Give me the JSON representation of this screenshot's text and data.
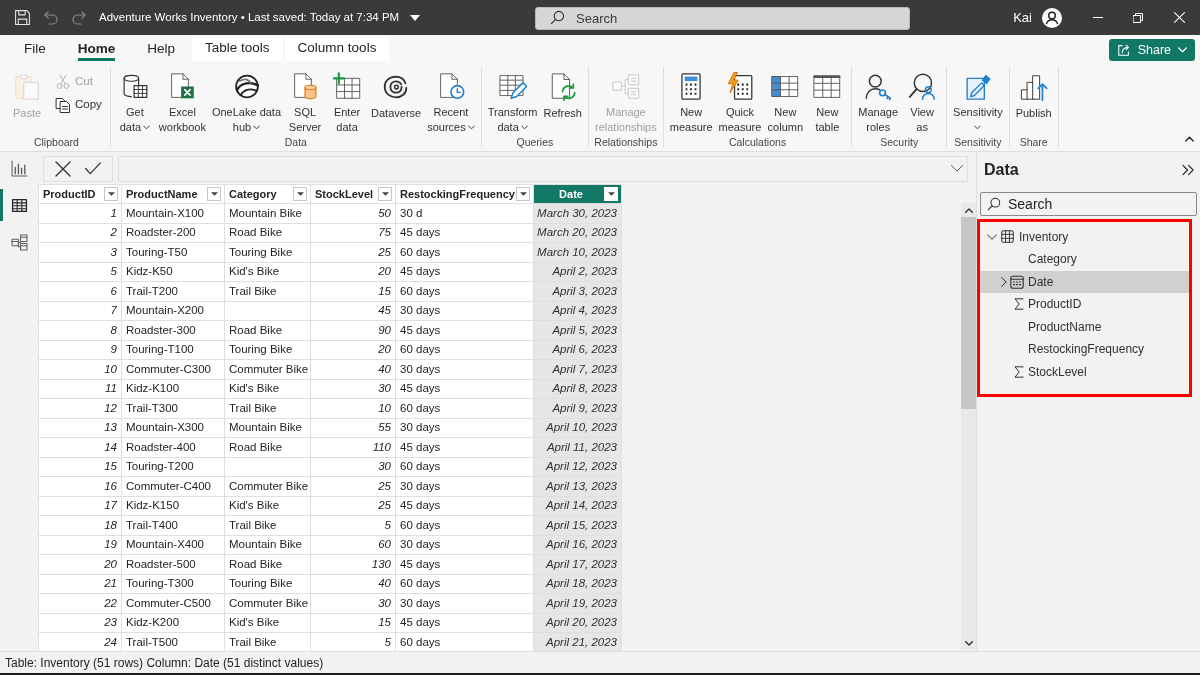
{
  "title_bar": {
    "title": "Adventure Works Inventory • Last saved: Today at 7:34 PM",
    "search_placeholder": "Search",
    "user": "Kai"
  },
  "ribbon": {
    "tabs": [
      {
        "label": "File",
        "kind": "standard",
        "selected": false
      },
      {
        "label": "Home",
        "kind": "standard",
        "selected": true
      },
      {
        "label": "Help",
        "kind": "standard",
        "selected": false
      },
      {
        "label": "Table tools",
        "kind": "contextual",
        "selected": false
      },
      {
        "label": "Column tools",
        "kind": "contextual",
        "selected": false
      }
    ],
    "share_button": "Share",
    "groups": [
      {
        "label": "Clipboard",
        "buttons": [
          {
            "lines": [
              "Paste"
            ],
            "kind": "large",
            "disabled": true,
            "dropdown": false
          },
          {
            "lines": [
              "Cut"
            ],
            "kind": "small",
            "disabled": true,
            "dropdown": false
          },
          {
            "lines": [
              "Copy"
            ],
            "kind": "small",
            "disabled": false,
            "dropdown": false
          }
        ]
      },
      {
        "label": "Data",
        "buttons": [
          {
            "lines": [
              "Get",
              "data"
            ],
            "kind": "large",
            "disabled": false,
            "dropdown": true
          },
          {
            "lines": [
              "Excel",
              "workbook"
            ],
            "kind": "large",
            "disabled": false,
            "dropdown": false
          },
          {
            "lines": [
              "OneLake data",
              "hub"
            ],
            "kind": "large",
            "disabled": false,
            "dropdown": true
          },
          {
            "lines": [
              "SQL",
              "Server"
            ],
            "kind": "large",
            "disabled": false,
            "dropdown": false
          },
          {
            "lines": [
              "Enter",
              "data"
            ],
            "kind": "large",
            "disabled": false,
            "dropdown": false
          },
          {
            "lines": [
              "Dataverse"
            ],
            "kind": "large",
            "disabled": false,
            "dropdown": false
          },
          {
            "lines": [
              "Recent",
              "sources"
            ],
            "kind": "large",
            "disabled": false,
            "dropdown": true
          }
        ]
      },
      {
        "label": "Queries",
        "buttons": [
          {
            "lines": [
              "Transform",
              "data"
            ],
            "kind": "large",
            "disabled": false,
            "dropdown": true
          },
          {
            "lines": [
              "Refresh"
            ],
            "kind": "large",
            "disabled": false,
            "dropdown": false
          }
        ]
      },
      {
        "label": "Relationships",
        "buttons": [
          {
            "lines": [
              "Manage",
              "relationships"
            ],
            "kind": "large",
            "disabled": true,
            "dropdown": false
          }
        ]
      },
      {
        "label": "Calculations",
        "buttons": [
          {
            "lines": [
              "New",
              "measure"
            ],
            "kind": "large",
            "disabled": false,
            "dropdown": false
          },
          {
            "lines": [
              "Quick",
              "measure"
            ],
            "kind": "large",
            "disabled": false,
            "dropdown": false
          },
          {
            "lines": [
              "New",
              "column"
            ],
            "kind": "large",
            "disabled": false,
            "dropdown": false
          },
          {
            "lines": [
              "New",
              "table"
            ],
            "kind": "large",
            "disabled": false,
            "dropdown": false
          }
        ]
      },
      {
        "label": "Security",
        "buttons": [
          {
            "lines": [
              "Manage",
              "roles"
            ],
            "kind": "large",
            "disabled": false,
            "dropdown": false
          },
          {
            "lines": [
              "View",
              "as"
            ],
            "kind": "large",
            "disabled": false,
            "dropdown": false
          }
        ]
      },
      {
        "label": "Sensitivity",
        "buttons": [
          {
            "lines": [
              "Sensitivity"
            ],
            "kind": "large",
            "disabled": false,
            "dropdown": true
          }
        ]
      },
      {
        "label": "Share",
        "buttons": [
          {
            "lines": [
              "Publish"
            ],
            "kind": "large",
            "disabled": false,
            "dropdown": false
          }
        ]
      }
    ]
  },
  "view_rail": [
    {
      "kind": "report",
      "selected": false
    },
    {
      "kind": "table",
      "selected": true
    },
    {
      "kind": "model",
      "selected": false
    }
  ],
  "table": {
    "columns": [
      {
        "label": "ProductID",
        "kind": "number",
        "selected": false
      },
      {
        "label": "ProductName",
        "kind": "text",
        "selected": false
      },
      {
        "label": "Category",
        "kind": "text",
        "selected": false
      },
      {
        "label": "StockLevel",
        "kind": "number",
        "selected": false
      },
      {
        "label": "RestockingFrequency",
        "kind": "text",
        "selected": false
      },
      {
        "label": "Date",
        "kind": "date",
        "selected": true
      }
    ],
    "rows": [
      [
        "1",
        "Mountain-X100",
        "Mountain Bike",
        "50",
        "30 d",
        "March 30, 2023"
      ],
      [
        "2",
        "Roadster-200",
        "Road Bike",
        "75",
        "45 days",
        "March 20, 2023"
      ],
      [
        "3",
        "Touring-T50",
        "Touring Bike",
        "25",
        "60 days",
        "March 10, 2023"
      ],
      [
        "5",
        "Kidz-K50",
        "Kid's Bike",
        "20",
        "45 days",
        "April 2, 2023"
      ],
      [
        "6",
        "Trail-T200",
        "Trail Bike",
        "15",
        "60 days",
        "April 3, 2023"
      ],
      [
        "7",
        "Mountain-X200",
        null,
        "45",
        "30 days",
        "April 4, 2023"
      ],
      [
        "8",
        "Roadster-300",
        "Road Bike",
        "90",
        "45 days",
        "April 5, 2023"
      ],
      [
        "9",
        "Touring-T100",
        "Touring Bike",
        "20",
        "60 days",
        "April 6, 2023"
      ],
      [
        "10",
        "Commuter-C300",
        "Commuter Bike",
        "40",
        "30 days",
        "April 7, 2023"
      ],
      [
        "11",
        "Kidz-K100",
        "Kid's Bike",
        "30",
        "45 days",
        "April 8, 2023"
      ],
      [
        "12",
        "Trail-T300",
        "Trail Bike",
        "10",
        "60 days",
        "April 9, 2023"
      ],
      [
        "13",
        "Mountain-X300",
        "Mountain Bike",
        "55",
        "30 days",
        "April 10, 2023"
      ],
      [
        "14",
        "Roadster-400",
        "Road Bike",
        "110",
        "45 days",
        "April 11, 2023"
      ],
      [
        "15",
        "Touring-T200",
        null,
        "30",
        "60 days",
        "April 12, 2023"
      ],
      [
        "16",
        "Commuter-C400",
        "Commuter Bike",
        "25",
        "30 days",
        "April 13, 2023"
      ],
      [
        "17",
        "Kidz-K150",
        "Kid's Bike",
        "25",
        "45 days",
        "April 14, 2023"
      ],
      [
        "18",
        "Trail-T400",
        "Trail Bike",
        "5",
        "60 days",
        "April 15, 2023"
      ],
      [
        "19",
        "Mountain-X400",
        "Mountain Bike",
        "60",
        "30 days",
        "April 16, 2023"
      ],
      [
        "20",
        "Roadster-500",
        "Road Bike",
        "130",
        "45 days",
        "April 17, 2023"
      ],
      [
        "21",
        "Touring-T300",
        "Touring Bike",
        "40",
        "60 days",
        "April 18, 2023"
      ],
      [
        "22",
        "Commuter-C500",
        "Commuter Bike",
        "30",
        "30 days",
        "April 19, 2023"
      ],
      [
        "23",
        "Kidz-K200",
        "Kid's Bike",
        "15",
        "45 days",
        "April 20, 2023"
      ],
      [
        "24",
        "Trail-T500",
        "Trail Bike",
        "5",
        "60 days",
        "April 21, 2023"
      ]
    ]
  },
  "data_pane": {
    "title": "Data",
    "search_placeholder": "Search",
    "highlighted": true,
    "tree": [
      {
        "label": "Inventory",
        "kind": "table",
        "expanded": true,
        "selected": false,
        "children": [
          {
            "label": "Category",
            "kind": "text",
            "selected": false
          },
          {
            "label": "Date",
            "kind": "date",
            "selected": true
          },
          {
            "label": "ProductID",
            "kind": "number",
            "selected": false
          },
          {
            "label": "ProductName",
            "kind": "text",
            "selected": false
          },
          {
            "label": "RestockingFrequency",
            "kind": "text",
            "selected": false
          },
          {
            "label": "StockLevel",
            "kind": "number",
            "selected": false
          }
        ]
      }
    ]
  },
  "status_bar": "Table: Inventory (51 rows) Column: Date (51 distinct values)"
}
